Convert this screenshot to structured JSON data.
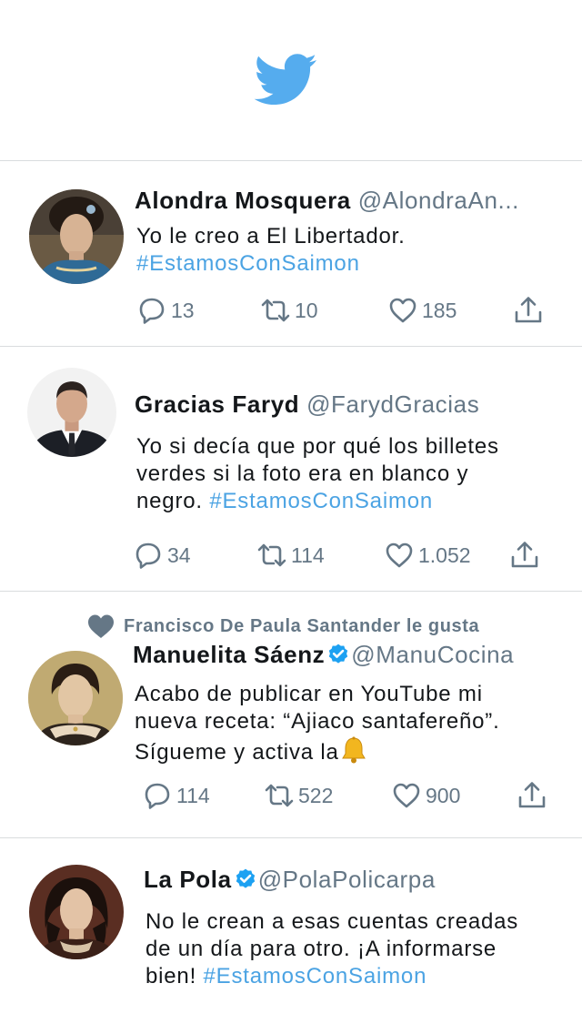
{
  "header": {
    "logo_icon": "twitter-bird-icon",
    "brand_color": "#55acee"
  },
  "colors": {
    "hashtag": "#4ba3e3",
    "secondary_text": "#657786",
    "verified": "#1da1f2"
  },
  "tweets": [
    {
      "name": "Alondra Mosquera",
      "handle": "@AlondraAn...",
      "verified": false,
      "text": "Yo le creo a El Libertador.",
      "hashtag": "#EstamosConSaimon",
      "replies": "13",
      "retweets": "10",
      "likes": "185"
    },
    {
      "name": "Gracias Faryd",
      "handle": "@FarydGracias",
      "verified": false,
      "text_line1": "Yo si decía que por qué los billetes",
      "text_line2": "verdes si la foto era en blanco y",
      "text_line3": "negro.",
      "hashtag": "#EstamosConSaimon",
      "replies": "34",
      "retweets": "114",
      "likes": "1.052"
    },
    {
      "liked_by": "Francisco De Paula Santander le gusta",
      "name": "Manuelita Sáenz",
      "handle": "@ManuCocina",
      "verified": true,
      "text_line1": "Acabo de publicar en YouTube mi",
      "text_line2": "nueva receta: “Ajiaco santafereño”.",
      "text_line3": "Sígueme y activa la",
      "emoji": "bell-icon",
      "replies": "114",
      "retweets": "522",
      "likes": "900"
    },
    {
      "name": "La Pola",
      "handle": "@PolaPolicarpa",
      "verified": true,
      "text_line1": "No le crean a esas cuentas creadas",
      "text_line2": "de un día para otro. ¡A informarse",
      "text_line3": "bien!",
      "hashtag": "#EstamosConSaimon"
    }
  ]
}
